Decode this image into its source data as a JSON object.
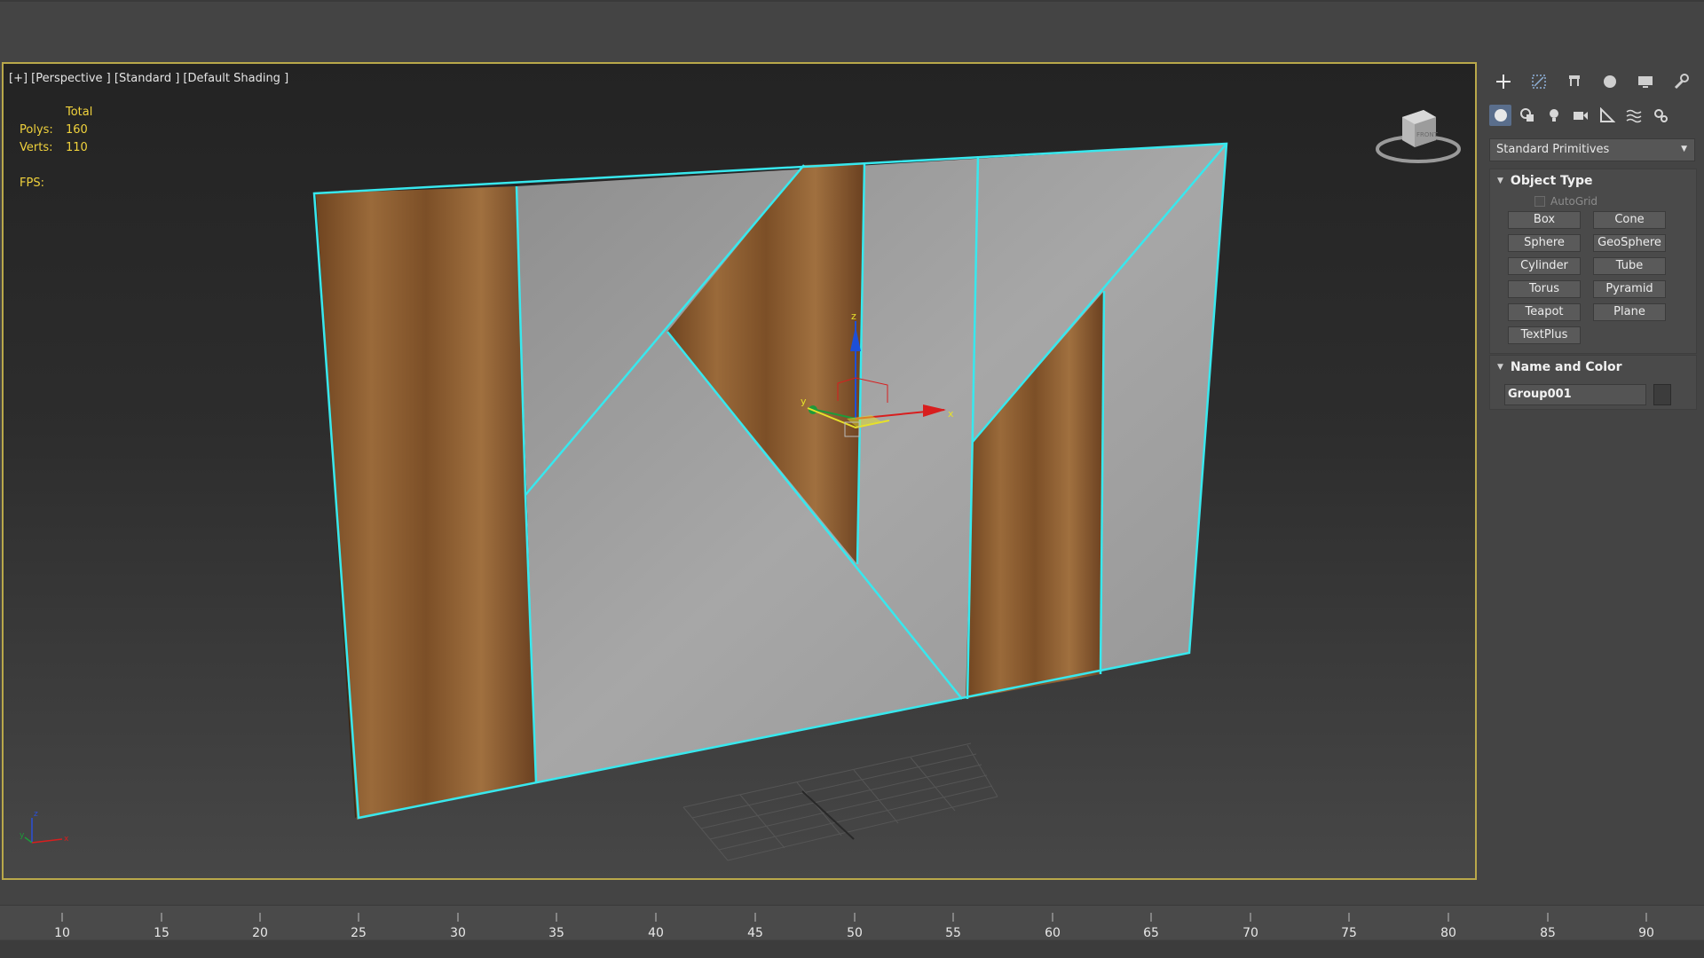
{
  "viewport": {
    "label": "[+] [Perspective ] [Standard ] [Default Shading ]",
    "stats": {
      "header": "Total",
      "polys_label": "Polys:",
      "polys_value": "160",
      "verts_label": "Verts:",
      "verts_value": "110",
      "fps_label": "FPS:"
    },
    "viewcube_face": "FRONT",
    "gizmo_axes": {
      "x": "x",
      "y": "y",
      "z": "z"
    },
    "colors": {
      "selection": "#38e8ee",
      "wood": "#8a5a2e",
      "concrete": "#9c9c9c",
      "border": "#b9a84a"
    }
  },
  "command_panel": {
    "tabs": [
      "create-icon",
      "modify-icon",
      "hierarchy-icon",
      "motion-icon",
      "display-icon",
      "utilities-icon"
    ],
    "subtabs": [
      "geometry-icon",
      "shapes-icon",
      "lights-icon",
      "cameras-icon",
      "helpers-icon",
      "spacewarps-icon",
      "systems-icon"
    ],
    "dropdown": "Standard Primitives",
    "object_type": {
      "title": "Object Type",
      "autogrid": "AutoGrid",
      "buttons": [
        "Box",
        "Cone",
        "Sphere",
        "GeoSphere",
        "Cylinder",
        "Tube",
        "Torus",
        "Pyramid",
        "Teapot",
        "Plane",
        "TextPlus"
      ]
    },
    "name_color": {
      "title": "Name and Color",
      "name": "Group001"
    }
  },
  "timeline": {
    "ticks": [
      "10",
      "15",
      "20",
      "25",
      "30",
      "35",
      "40",
      "45",
      "50",
      "55",
      "60",
      "65",
      "70",
      "75",
      "80",
      "85",
      "90"
    ]
  }
}
